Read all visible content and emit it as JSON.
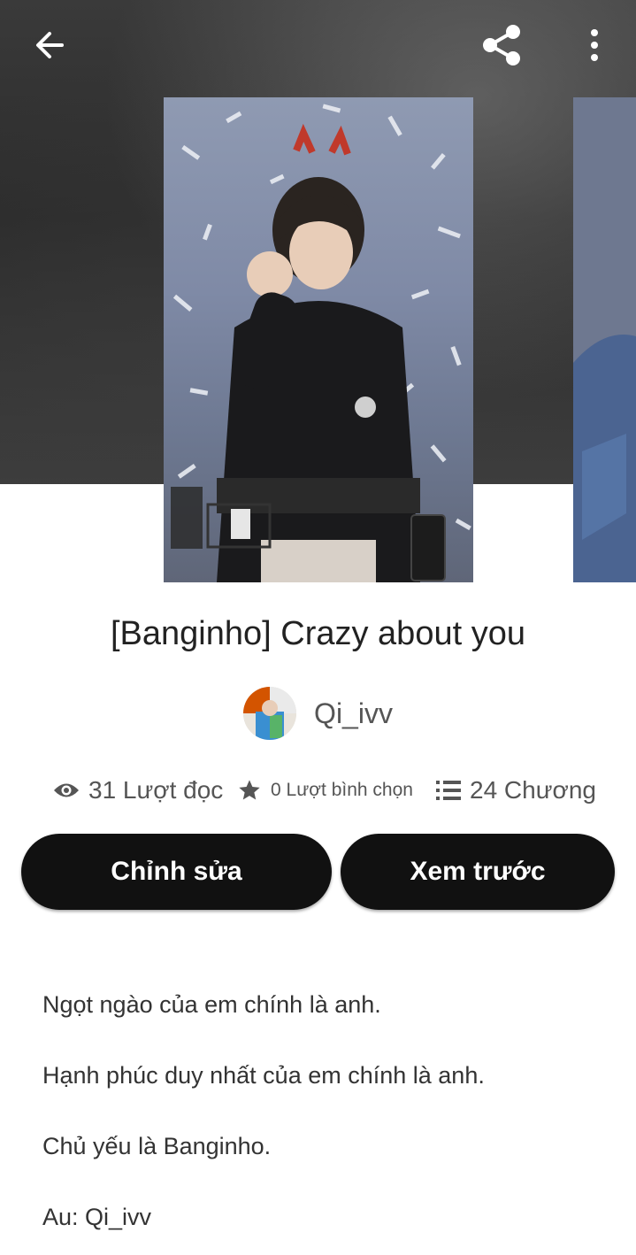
{
  "colors": {
    "button_bg": "#111111",
    "button_text": "#ffffff",
    "header_bg": "#2f2f2f",
    "text_muted": "#555555"
  },
  "header": {
    "back_icon": "arrow-left-icon",
    "share_icon": "share-icon",
    "more_icon": "more-vertical-icon"
  },
  "story": {
    "title": "[Banginho] Crazy about you",
    "author": "Qi_ivv"
  },
  "stats": {
    "reads": "31 Lượt đọc",
    "votes": "0 Lượt bình chọn",
    "parts": "24 Chương"
  },
  "actions": {
    "edit_label": "Chỉnh sửa",
    "preview_label": "Xem trước"
  },
  "description": [
    "Ngọt ngào của em chính là anh.",
    "Hạnh phúc duy nhất của em chính là anh.",
    "Chủ yếu là Banginho.",
    "Au: Qi_ivv"
  ]
}
